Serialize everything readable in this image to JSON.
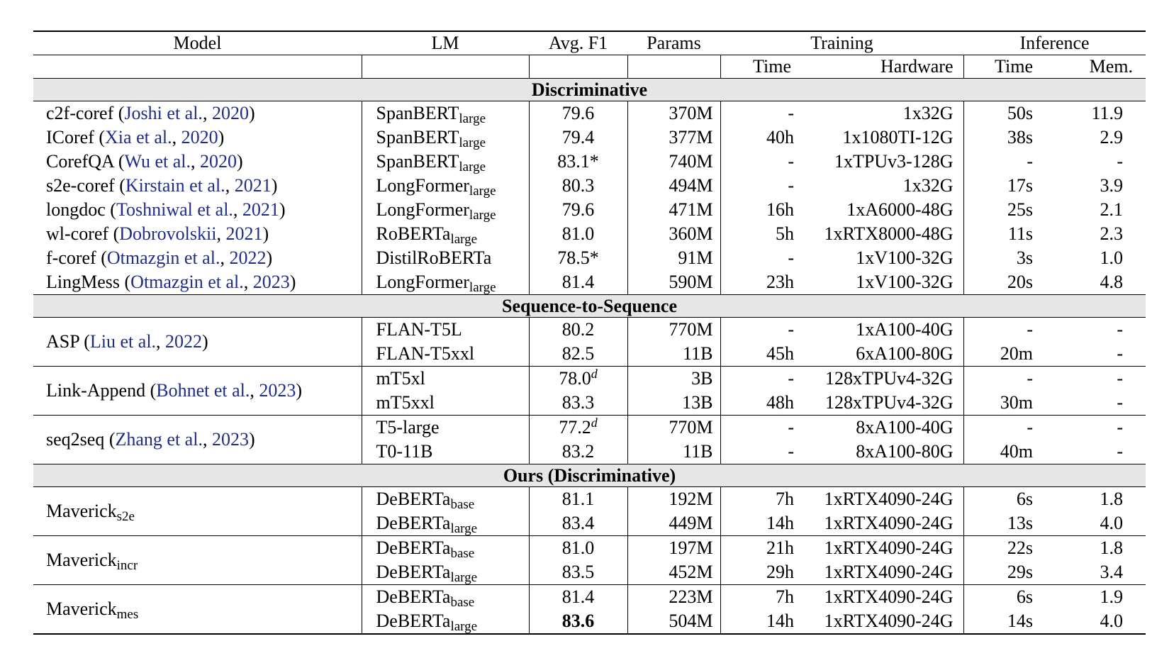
{
  "headers": {
    "model": "Model",
    "lm": "LM",
    "f1": "Avg. F1",
    "params": "Params",
    "training": "Training",
    "inference": "Inference",
    "train_time": "Time",
    "hardware": "Hardware",
    "inf_time": "Time",
    "mem": "Mem."
  },
  "sections": {
    "discriminative": "Discriminative",
    "seq2seq": "Sequence-to-Sequence",
    "ours": "Ours (Discriminative)"
  },
  "disc": [
    {
      "name": "c2f-coref",
      "a": "Joshi et al.",
      "y": "2020",
      "lm": "SpanBERT",
      "sub": "large",
      "f1": "79.6",
      "params": "370M",
      "tt": "-",
      "hw": "1x32G",
      "it": "50s",
      "mem": "11.9"
    },
    {
      "name": "ICoref",
      "a": "Xia et al.",
      "y": "2020",
      "lm": "SpanBERT",
      "sub": "large",
      "f1": "79.4",
      "params": "377M",
      "tt": "40h",
      "hw": "1x1080TI-12G",
      "it": "38s",
      "mem": "2.9"
    },
    {
      "name": "CorefQA",
      "a": "Wu et al.",
      "y": "2020",
      "lm": "SpanBERT",
      "sub": "large",
      "f1": "83.1*",
      "params": "740M",
      "tt": "-",
      "hw": "1xTPUv3-128G",
      "it": "-",
      "mem": "-"
    },
    {
      "name": "s2e-coref",
      "a": "Kirstain et al.",
      "y": "2021",
      "lm": "LongFormer",
      "sub": "large",
      "f1": "80.3",
      "params": "494M",
      "tt": "-",
      "hw": "1x32G",
      "it": "17s",
      "mem": "3.9"
    },
    {
      "name": "longdoc",
      "a": "Toshniwal et al.",
      "y": "2021",
      "lm": "LongFormer",
      "sub": "large",
      "f1": "79.6",
      "params": "471M",
      "tt": "16h",
      "hw": "1xA6000-48G",
      "it": "25s",
      "mem": "2.1"
    },
    {
      "name": "wl-coref",
      "a": "Dobrovolskii",
      "y": "2021",
      "lm": "RoBERTa",
      "sub": "large",
      "f1": "81.0",
      "params": "360M",
      "tt": "5h",
      "hw": "1xRTX8000-48G",
      "it": "11s",
      "mem": "2.3"
    },
    {
      "name": "f-coref",
      "a": "Otmazgin et al.",
      "y": "2022",
      "lm": "DistilRoBERTa",
      "sub": "",
      "f1": "78.5*",
      "params": "91M",
      "tt": "-",
      "hw": "1xV100-32G",
      "it": "3s",
      "mem": "1.0"
    },
    {
      "name": "LingMess",
      "a": "Otmazgin et al.",
      "y": "2023",
      "lm": "LongFormer",
      "sub": "large",
      "f1": "81.4",
      "params": "590M",
      "tt": "23h",
      "hw": "1xV100-32G",
      "it": "20s",
      "mem": "4.8"
    }
  ],
  "seq": [
    {
      "name": "ASP",
      "a": "Liu et al.",
      "y": "2022",
      "rows": [
        {
          "lm": "FLAN-T5L",
          "f1": "80.2",
          "f1sup": "",
          "params": "770M",
          "tt": "-",
          "hw": "1xA100-40G",
          "it": "-",
          "mem": "-"
        },
        {
          "lm": "FLAN-T5xxl",
          "f1": "82.5",
          "f1sup": "",
          "params": "11B",
          "tt": "45h",
          "hw": "6xA100-80G",
          "it": "20m",
          "mem": "-"
        }
      ]
    },
    {
      "name": "Link-Append",
      "a": "Bohnet et al.",
      "y": "2023",
      "rows": [
        {
          "lm": "mT5xl",
          "f1": "78.0",
          "f1sup": "d",
          "params": "3B",
          "tt": "-",
          "hw": "128xTPUv4-32G",
          "it": "-",
          "mem": "-"
        },
        {
          "lm": "mT5xxl",
          "f1": "83.3",
          "f1sup": "",
          "params": "13B",
          "tt": "48h",
          "hw": "128xTPUv4-32G",
          "it": "30m",
          "mem": "-"
        }
      ]
    },
    {
      "name": "seq2seq",
      "a": "Zhang et al.",
      "y": "2023",
      "rows": [
        {
          "lm": "T5-large",
          "f1": "77.2",
          "f1sup": "d",
          "params": "770M",
          "tt": "-",
          "hw": "8xA100-40G",
          "it": "-",
          "mem": "-"
        },
        {
          "lm": "T0-11B",
          "f1": "83.2",
          "f1sup": "",
          "params": "11B",
          "tt": "-",
          "hw": "8xA100-80G",
          "it": "40m",
          "mem": "-"
        }
      ]
    }
  ],
  "ours": [
    {
      "name": "Maverick",
      "sub": "s2e",
      "rows": [
        {
          "lm": "DeBERTa",
          "sub": "base",
          "f1": "81.1",
          "params": "192M",
          "tt": "7h",
          "hw": "1xRTX4090-24G",
          "it": "6s",
          "mem": "1.8"
        },
        {
          "lm": "DeBERTa",
          "sub": "large",
          "f1": "83.4",
          "params": "449M",
          "tt": "14h",
          "hw": "1xRTX4090-24G",
          "it": "13s",
          "mem": "4.0"
        }
      ]
    },
    {
      "name": "Maverick",
      "sub": "incr",
      "rows": [
        {
          "lm": "DeBERTa",
          "sub": "base",
          "f1": "81.0",
          "params": "197M",
          "tt": "21h",
          "hw": "1xRTX4090-24G",
          "it": "22s",
          "mem": "1.8"
        },
        {
          "lm": "DeBERTa",
          "sub": "large",
          "f1": "83.5",
          "params": "452M",
          "tt": "29h",
          "hw": "1xRTX4090-24G",
          "it": "29s",
          "mem": "3.4"
        }
      ]
    },
    {
      "name": "Maverick",
      "sub": "mes",
      "rows": [
        {
          "lm": "DeBERTa",
          "sub": "base",
          "f1": "81.4",
          "params": "223M",
          "tt": "7h",
          "hw": "1xRTX4090-24G",
          "it": "6s",
          "mem": "1.9"
        },
        {
          "lm": "DeBERTa",
          "sub": "large",
          "f1": "83.6",
          "bold": true,
          "params": "504M",
          "tt": "14h",
          "hw": "1xRTX4090-24G",
          "it": "14s",
          "mem": "4.0"
        }
      ]
    }
  ]
}
